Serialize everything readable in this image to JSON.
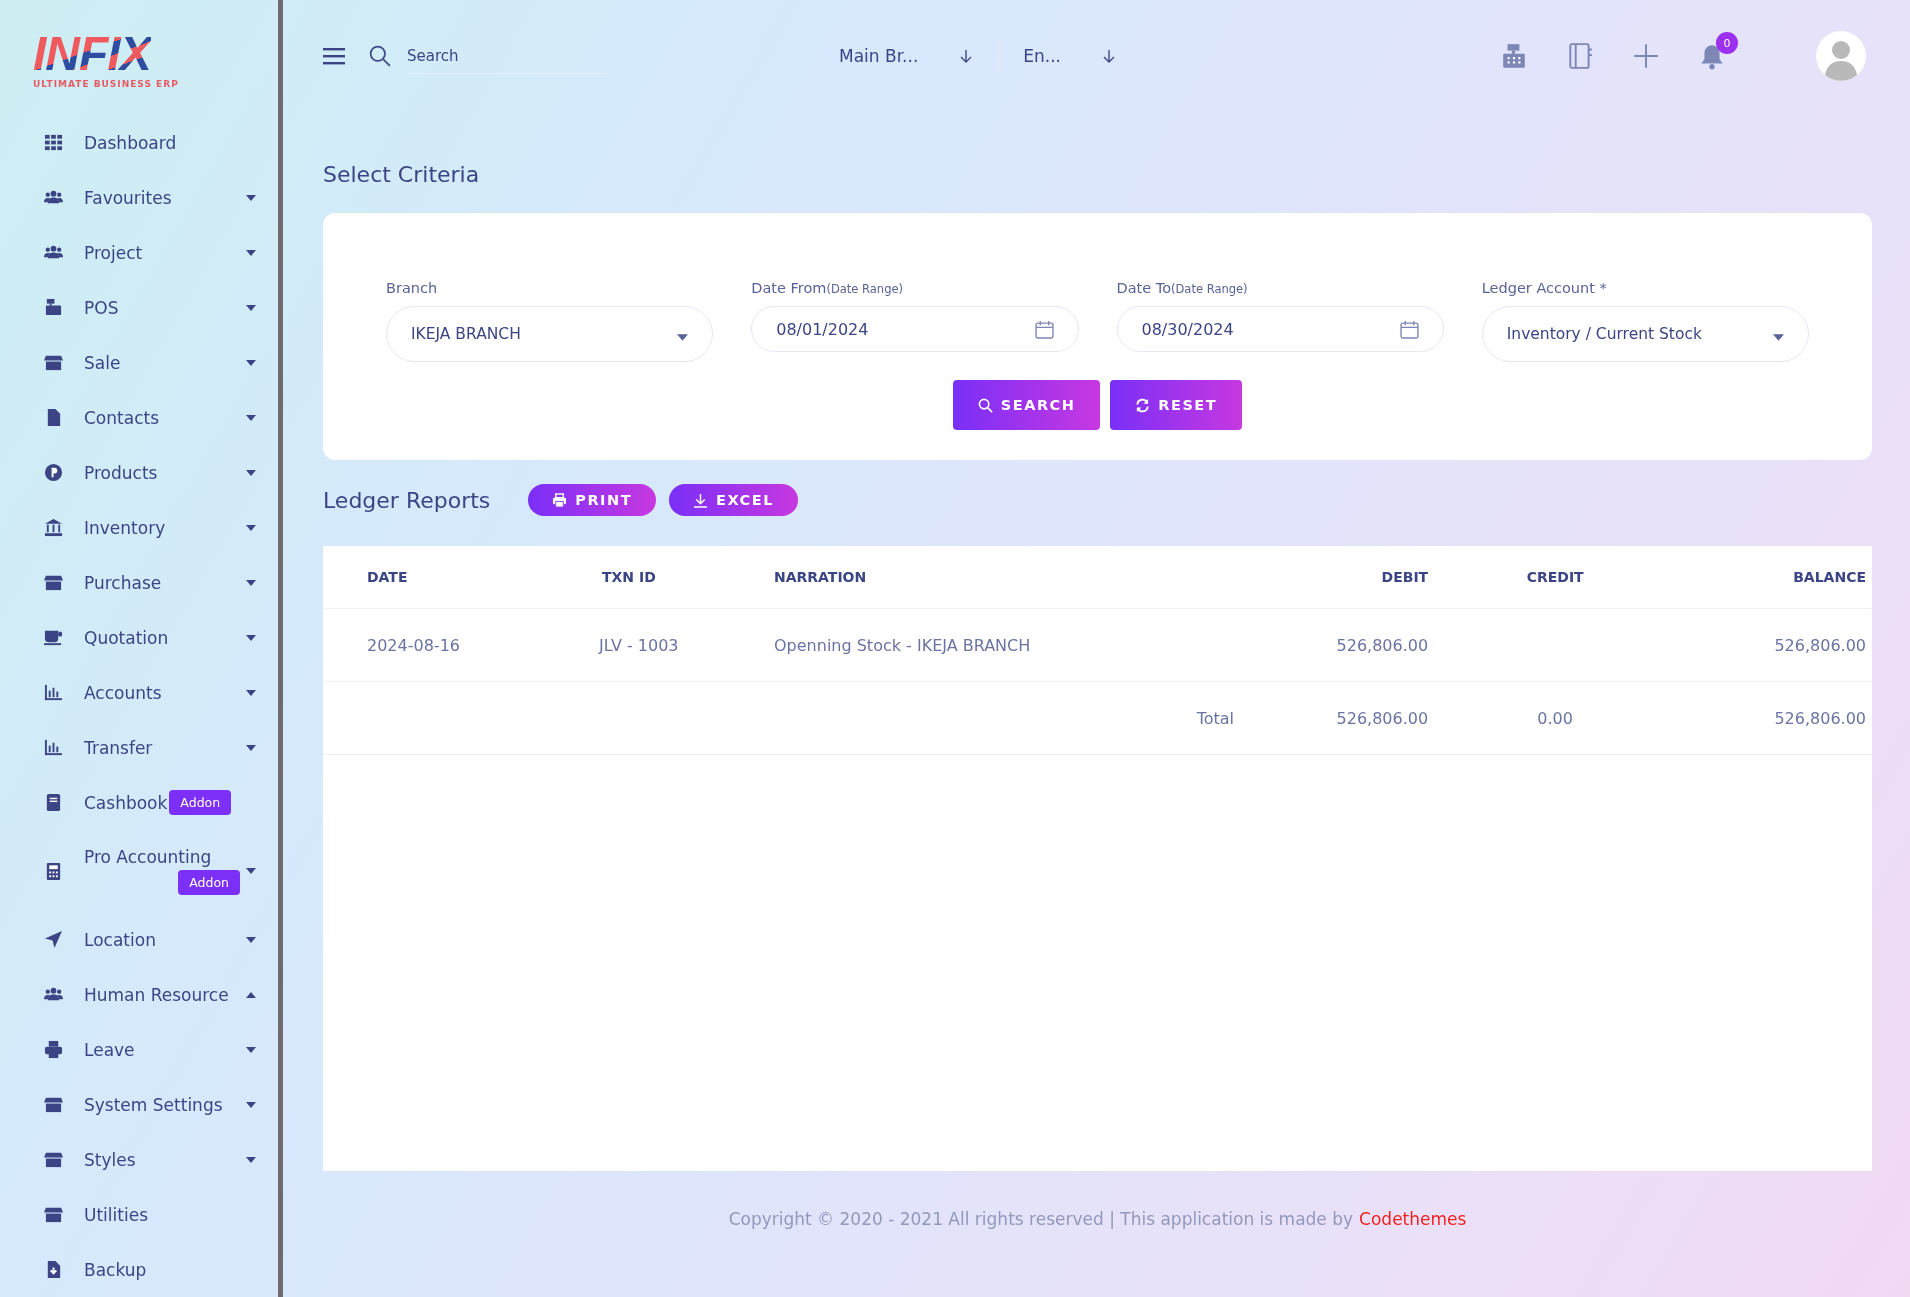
{
  "logo": {
    "wordmark": "INFIX",
    "tagline": "ULTIMATE BUSINESS ERP"
  },
  "sidebar": {
    "items": [
      {
        "kind": "link",
        "label": "Dashboard"
      },
      {
        "kind": "submenu",
        "label": "Favourites",
        "expanded": false
      },
      {
        "kind": "submenu",
        "label": "Project",
        "expanded": false
      },
      {
        "kind": "submenu",
        "label": "POS",
        "expanded": false
      },
      {
        "kind": "submenu",
        "label": "Sale",
        "expanded": false
      },
      {
        "kind": "submenu",
        "label": "Contacts",
        "expanded": false
      },
      {
        "kind": "submenu",
        "label": "Products",
        "expanded": false
      },
      {
        "kind": "submenu",
        "label": "Inventory",
        "expanded": false
      },
      {
        "kind": "submenu",
        "label": "Purchase",
        "expanded": false
      },
      {
        "kind": "submenu",
        "label": "Quotation",
        "expanded": false
      },
      {
        "kind": "submenu",
        "label": "Accounts",
        "expanded": false
      },
      {
        "kind": "submenu",
        "label": "Transfer",
        "expanded": false
      },
      {
        "kind": "link",
        "label": "Cashbook",
        "badge": "Addon"
      },
      {
        "kind": "submenu",
        "label": "Pro Accounting",
        "expanded": false,
        "badge": "Addon"
      },
      {
        "kind": "submenu",
        "label": "Location",
        "expanded": false
      },
      {
        "kind": "submenu",
        "label": "Human Resource",
        "expanded": true
      },
      {
        "kind": "submenu",
        "label": "Leave",
        "expanded": false
      },
      {
        "kind": "submenu",
        "label": "System Settings",
        "expanded": false
      },
      {
        "kind": "submenu",
        "label": "Styles",
        "expanded": false
      },
      {
        "kind": "link",
        "label": "Utilities"
      },
      {
        "kind": "link",
        "label": "Backup"
      }
    ]
  },
  "header": {
    "search": {
      "placeholder": "Search"
    },
    "branch_select": "Main Br...",
    "language_select": "En...",
    "notification_count": "0"
  },
  "criteria": {
    "title": "Select Criteria",
    "fields": [
      {
        "kind": "select",
        "label": "Branch",
        "value": "IKEJA BRANCH"
      },
      {
        "kind": "date",
        "label": "Date From",
        "note": "(Date Range)",
        "value": "08/01/2024"
      },
      {
        "kind": "date",
        "label": "Date To",
        "note": "(Date Range)",
        "value": "08/30/2024"
      },
      {
        "kind": "select",
        "label": "Ledger Account *",
        "value": "Inventory / Current Stock"
      }
    ],
    "buttons": [
      {
        "kind": "search",
        "label": "SEARCH"
      },
      {
        "kind": "reset",
        "label": "RESET"
      }
    ]
  },
  "report": {
    "title": "Ledger Reports",
    "buttons": [
      {
        "kind": "print",
        "label": "PRINT"
      },
      {
        "kind": "excel",
        "label": "EXCEL"
      }
    ],
    "table": {
      "columns": [
        "DATE",
        "TXN ID",
        "NARRATION",
        "DEBIT",
        "CREDIT",
        "BALANCE"
      ],
      "rows": [
        [
          "2024-08-16",
          "JLV - 1003",
          "Openning Stock - IKEJA BRANCH",
          "526,806.00",
          "",
          "526,806.00"
        ]
      ],
      "total": {
        "label": "Total",
        "debit": "526,806.00",
        "credit": "0.00",
        "balance": "526,806.00"
      }
    }
  },
  "footer": {
    "text": "Copyright © 2020 - 2021 All rights reserved | This application is made by",
    "link": "Codethemes"
  }
}
